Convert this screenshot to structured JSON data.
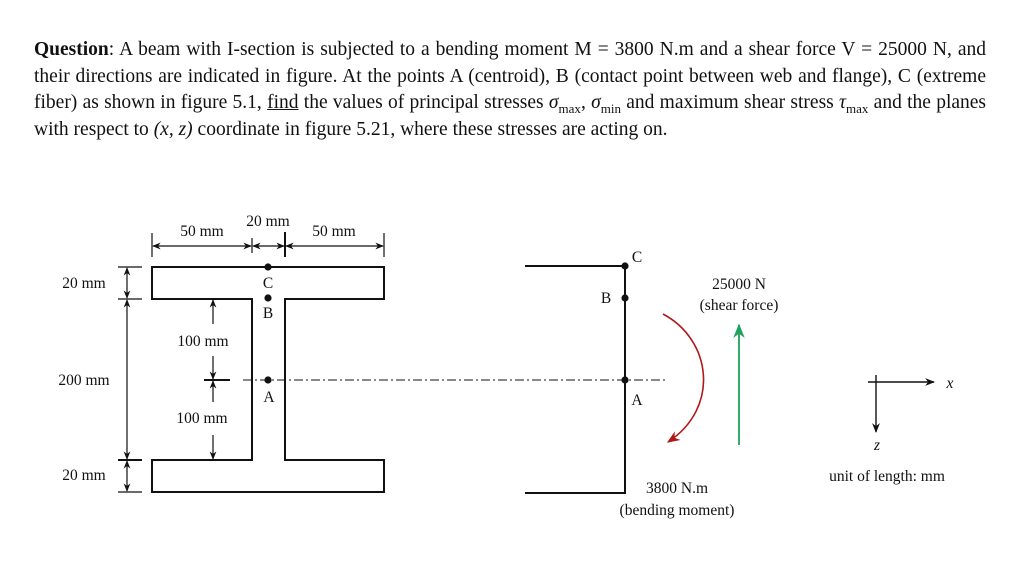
{
  "question": {
    "heading": "Question",
    "parts": [
      ": A beam with I-section is subjected to a bending moment M = 3800 N.m and a shear force V = 25000 N, and their directions are indicated in figure. At the points A (centroid), B (contact point between web and flange), C (extreme fiber) as shown in figure 5.1, ",
      "find",
      " the values of principal stresses ",
      " and maximum shear stress ",
      " and the planes with respect to ",
      " coordinate in figure 5.21, where these stresses are acting on."
    ],
    "sigma_max": {
      "symbol": "σ",
      "sub": "max"
    },
    "sigma_min": {
      "symbol": "σ",
      "sub": "min"
    },
    "tau_max": {
      "symbol": "τ",
      "sub": "max"
    },
    "coords": "(x, z)"
  },
  "section_figure": {
    "dim_top_left": "50 mm",
    "dim_top_web": "20 mm",
    "dim_top_right": "50 mm",
    "dim_flange_top": "20 mm",
    "dim_web_height": "200 mm",
    "dim_flange_bottom": "20 mm",
    "dim_upper_half": "100 mm",
    "dim_lower_half": "100 mm",
    "point_c": "C",
    "point_b": "B",
    "point_a": "A"
  },
  "side_figure": {
    "point_c": "C",
    "point_b": "B",
    "point_a": "A",
    "shear_value": "25000 N",
    "shear_caption": "(shear force)",
    "moment_value": "3800 N.m",
    "moment_caption": "(bending moment)",
    "shear_color": "#1fa35a",
    "moment_color": "#b01818"
  },
  "axes": {
    "x_label": "x",
    "z_label": "z",
    "unit_note": "unit of length: mm"
  }
}
